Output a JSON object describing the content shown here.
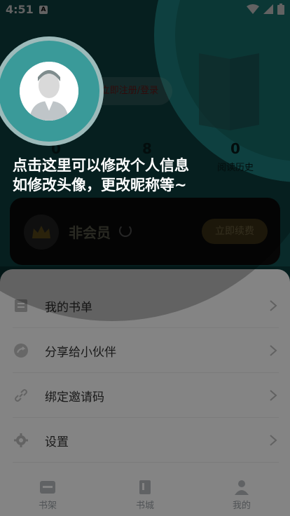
{
  "status": {
    "time": "4:51",
    "notif_badge": "A"
  },
  "profile": {
    "register_label": "立即注册/登录"
  },
  "stats": [
    {
      "value": "0",
      "label": "书"
    },
    {
      "value": "8",
      "label": ""
    },
    {
      "value": "0",
      "label": "阅读历史"
    }
  ],
  "membership": {
    "status_label": "非会员",
    "renew_label": "立即续费"
  },
  "guide": {
    "line1": "点击这里可以修改个人信息",
    "line2": "如修改头像，更改昵称等~"
  },
  "menu": [
    {
      "label": "我的书单",
      "icon": "list-icon"
    },
    {
      "label": "分享给小伙伴",
      "icon": "share-icon"
    },
    {
      "label": "绑定邀请码",
      "icon": "link-icon"
    },
    {
      "label": "设置",
      "icon": "gear-icon"
    }
  ],
  "tabs": [
    {
      "label": "书架",
      "icon": "bookshelf-icon"
    },
    {
      "label": "书城",
      "icon": "bookstore-icon"
    },
    {
      "label": "我的",
      "icon": "person-icon"
    }
  ],
  "colors": {
    "accent_teal": "#27a9a6",
    "renew_gold": "#8a7b52",
    "panel_bg": "#ffffff",
    "overlay": "#000000"
  }
}
